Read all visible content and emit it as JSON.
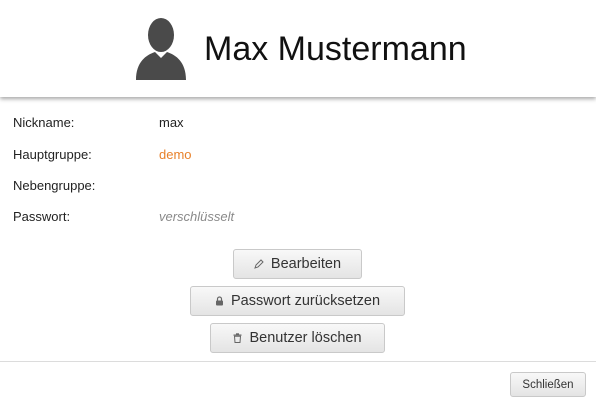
{
  "header": {
    "user_name": "Max Mustermann",
    "avatar_icon": "user-silhouette-icon"
  },
  "fields": {
    "nickname": {
      "label": "Nickname:",
      "value": "max"
    },
    "primary_group": {
      "label": "Hauptgruppe:",
      "value": "demo"
    },
    "secondary_group": {
      "label": "Nebengruppe:",
      "value": ""
    },
    "password": {
      "label": "Passwort:",
      "value": "verschlüsselt"
    }
  },
  "actions": {
    "edit": {
      "label": "Bearbeiten",
      "icon": "pencil-icon"
    },
    "reset_password": {
      "label": "Passwort zurücksetzen",
      "icon": "lock-icon"
    },
    "delete_user": {
      "label": "Benutzer löschen",
      "icon": "trash-icon"
    }
  },
  "footer": {
    "close_label": "Schließen"
  },
  "colors": {
    "link": "#e8812a",
    "muted": "#8a8a8a",
    "avatar": "#4a4a4a"
  }
}
